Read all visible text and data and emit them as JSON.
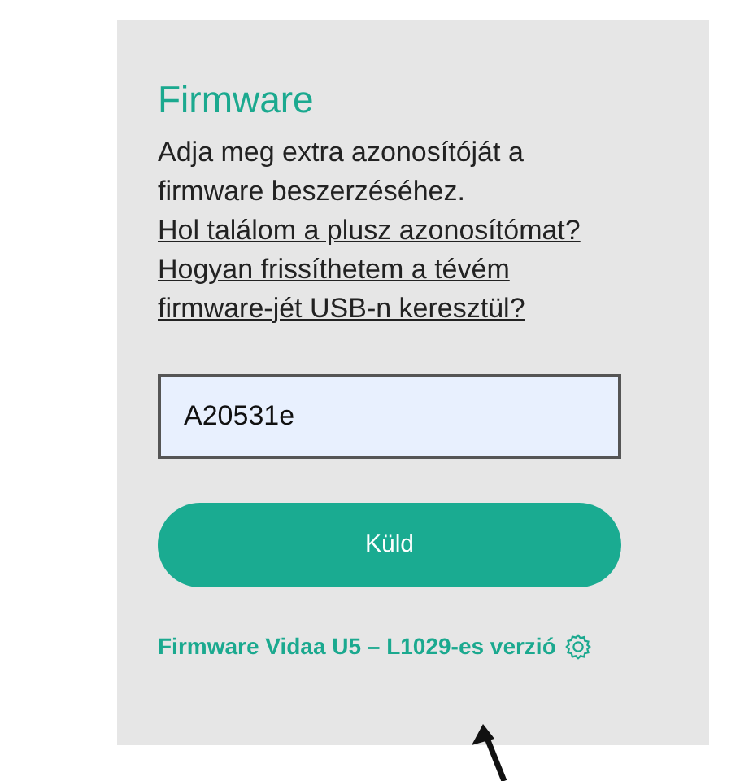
{
  "title": "Firmware",
  "intro": "Adja meg extra azonosítóját a firmware beszerzéséhez.",
  "links": [
    "Hol találom a plusz azonosítómat?",
    "Hogyan frissíthetem a tévém firmware-jét USB-n keresztül?"
  ],
  "id_field": {
    "value": "A20531e"
  },
  "submit_button": "Küld",
  "version_link": "Firmware Vidaa U5 – L1029-es verzió"
}
